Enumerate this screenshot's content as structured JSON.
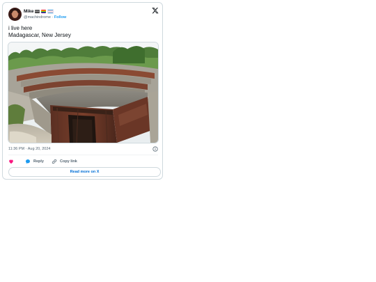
{
  "author": {
    "name": "Mike",
    "handle": "@machindrome",
    "separator": "·",
    "follow_label": "Follow",
    "name_badges": [
      "flag-emoji",
      "rainbow-flag-emoji",
      "trans-flag-emoji"
    ]
  },
  "tweet": {
    "lines": [
      "i live here",
      "Madagascar, New Jersey"
    ],
    "media_description_icon": "photo",
    "timestamp_time": "11:36 PM",
    "timestamp_sep": "·",
    "timestamp_date": "Aug 20, 2024"
  },
  "actions": {
    "like_icon": "heart-icon",
    "reply_label": "Reply",
    "copy_link_label": "Copy link",
    "read_more_label": "Read more on X"
  },
  "colors": {
    "link_blue": "#1d9bf0",
    "read_more_blue": "#006fd6",
    "heart_pink": "#f91880",
    "border": "#cfd9de",
    "muted_text": "#536471"
  }
}
